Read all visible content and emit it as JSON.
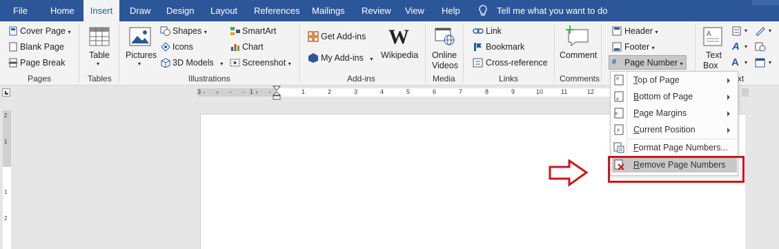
{
  "tabs": [
    "File",
    "Home",
    "Insert",
    "Draw",
    "Design",
    "Layout",
    "References",
    "Mailings",
    "Review",
    "View",
    "Help"
  ],
  "tell_me": "Tell me what you want to do",
  "pages_group": {
    "label": "Pages",
    "cover": "Cover Page",
    "blank": "Blank Page",
    "break": "Page Break"
  },
  "tables_group": {
    "label": "Tables",
    "table": "Table"
  },
  "illustrations_group": {
    "label": "Illustrations",
    "pictures": "Pictures",
    "shapes": "Shapes",
    "icons": "Icons",
    "models": "3D Models",
    "smartart": "SmartArt",
    "chart": "Chart",
    "screenshot": "Screenshot"
  },
  "addins_group": {
    "label": "Add-ins",
    "get": "Get Add-ins",
    "my": "My Add-ins",
    "wikipedia": "Wikipedia"
  },
  "media_group": {
    "label": "Media",
    "online1": "Online",
    "online2": "Videos"
  },
  "links_group": {
    "label": "Links",
    "link": "Link",
    "bookmark": "Bookmark",
    "xref": "Cross-reference"
  },
  "comments_group": {
    "label": "Comments",
    "comment": "Comment"
  },
  "hf_group": {
    "header": "Header",
    "footer": "Footer",
    "page_number": "Page Number"
  },
  "text_group": {
    "label_partial": "xt",
    "textbox1": "Text",
    "textbox2": "Box"
  },
  "ruler_numbers": [
    "3",
    "1",
    "1",
    "2",
    "3",
    "4",
    "5",
    "6",
    "7",
    "8",
    "9",
    "10",
    "11",
    "12"
  ],
  "ruler_left_numbers": [
    "2",
    "1",
    "1",
    "2"
  ],
  "menu": {
    "top_of_page_u": "T",
    "top_of_page": "op of Page",
    "bottom_of_page_u": "B",
    "bottom_of_page": "ottom of Page",
    "page_margins_u": "P",
    "page_margins": "age Margins",
    "current_position_u": "C",
    "current_position": "urrent Position",
    "format_u": "F",
    "format": "ormat Page Numbers...",
    "remove_u": "R",
    "remove": "emove Page Numbers"
  },
  "colors": {
    "brand": "#2b579a",
    "highlight": "#d0141b",
    "selected": "#c8c8c8"
  }
}
